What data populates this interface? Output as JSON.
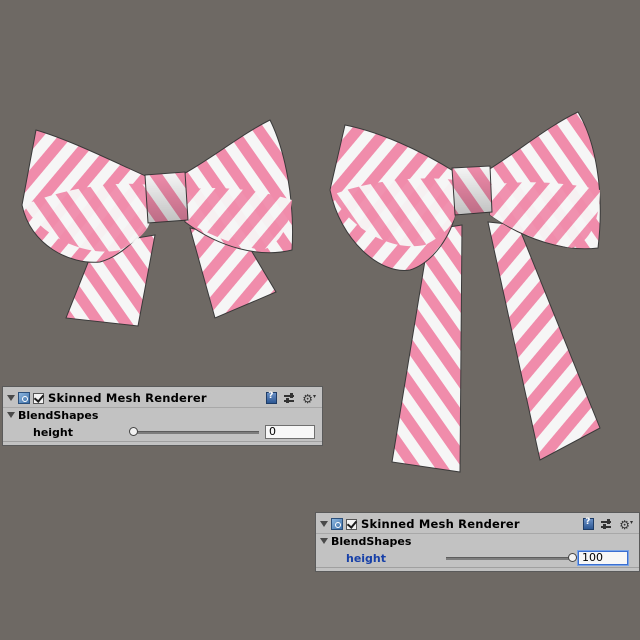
{
  "scene": {
    "background": "#6e6964",
    "ribbon_pink": "#f08cab",
    "ribbon_white": "#f6f6f6"
  },
  "inspector_before": {
    "component_title": "Skinned Mesh Renderer",
    "enabled": true,
    "section": "BlendShapes",
    "property_label": "height",
    "value_text": "0",
    "value": 0,
    "min": 0,
    "max": 100,
    "icons": [
      "fold-triangle-icon",
      "mesh-renderer-icon",
      "checkbox-icon",
      "help-book-icon",
      "preset-icon",
      "gear-icon"
    ]
  },
  "inspector_after": {
    "component_title": "Skinned Mesh Renderer",
    "enabled": true,
    "section": "BlendShapes",
    "property_label": "height",
    "value_text": "100",
    "value": 100,
    "min": 0,
    "max": 100,
    "label_color": "#1740a8",
    "icons": [
      "fold-triangle-icon",
      "mesh-renderer-icon",
      "checkbox-icon",
      "help-book-icon",
      "preset-icon",
      "gear-icon"
    ]
  }
}
